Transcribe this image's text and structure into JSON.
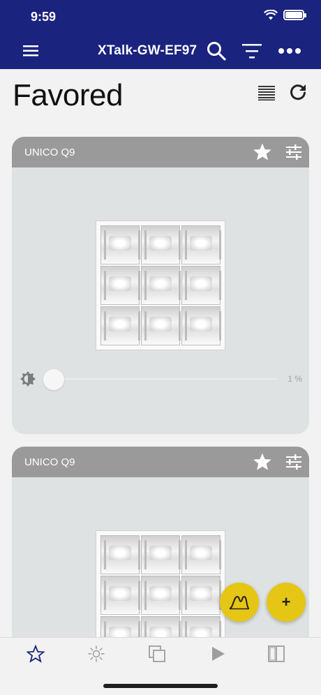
{
  "status": {
    "time": "9:59"
  },
  "appbar": {
    "title": "XTalk-GW-EF97"
  },
  "page": {
    "title": "Favored"
  },
  "cards": [
    {
      "name": "UNICO Q9",
      "favorited": true,
      "brightness": {
        "value": 1,
        "label": "1 %"
      }
    },
    {
      "name": "UNICO Q9",
      "favorited": true
    }
  ],
  "icons": {
    "menu": "hamburger-icon",
    "search": "search-icon",
    "filter": "filter-icon",
    "more": "more-horizontal-icon",
    "list_view": "list-view-icon",
    "refresh": "refresh-icon",
    "star": "star-icon",
    "settings": "sliders-icon",
    "brightness": "brightness-icon",
    "curve": "light-curve-icon",
    "add": "plus-icon"
  },
  "fab": {
    "add_label": "+"
  },
  "tabs": [
    {
      "name": "favorites",
      "active": true
    },
    {
      "name": "lights",
      "active": false
    },
    {
      "name": "groups",
      "active": false
    },
    {
      "name": "scenes",
      "active": false
    },
    {
      "name": "rooms",
      "active": false
    }
  ],
  "colors": {
    "primary": "#1a237e",
    "accent": "#e5c615",
    "card": "#dfe2e3",
    "card_header": "#9a9a9a"
  }
}
